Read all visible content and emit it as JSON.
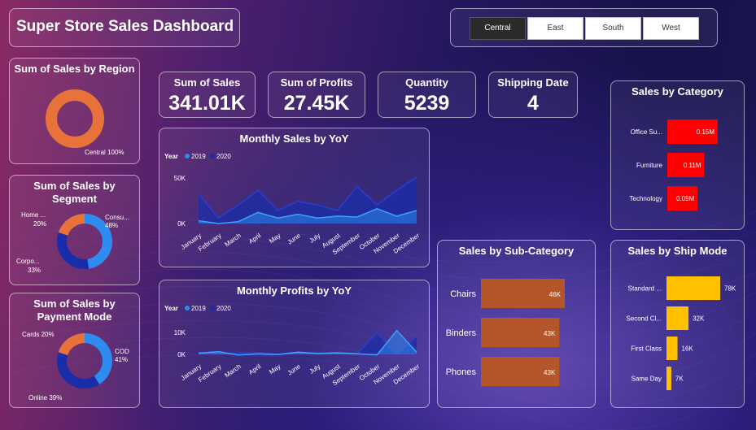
{
  "dashboard": {
    "title": "Super Store Sales Dashboard"
  },
  "region_slicer": {
    "options": [
      "Central",
      "East",
      "South",
      "West"
    ],
    "selected": "Central"
  },
  "region_chart": {
    "title": "Sum of Sales by Region",
    "label": "Central 100%",
    "color": "#E8733A"
  },
  "segment_chart": {
    "title": "Sum of Sales by Segment",
    "slices": [
      {
        "name": "Consu...",
        "pct": "48%",
        "value": 48,
        "color": "#2E8BEF"
      },
      {
        "name": "Corpo...",
        "pct": "33%",
        "value": 33,
        "color": "#1A2DA8"
      },
      {
        "name": "Home ...",
        "pct": "20%",
        "value": 20,
        "color": "#E8733A"
      }
    ]
  },
  "payment_chart": {
    "title": "Sum of Sales by Payment Mode",
    "slices": [
      {
        "name": "COD",
        "pct": "41%",
        "value": 41,
        "color": "#2E8BEF"
      },
      {
        "name": "Online",
        "pct": "39%",
        "value": 39,
        "color": "#1A2DA8"
      },
      {
        "name": "Cards",
        "pct": "20%",
        "value": 20,
        "color": "#E8733A"
      }
    ]
  },
  "kpis": {
    "sales": {
      "label": "Sum of Sales",
      "value": "341.01K"
    },
    "profits": {
      "label": "Sum of Profits",
      "value": "27.45K"
    },
    "quantity": {
      "label": "Quantity",
      "value": "5239"
    },
    "shipping": {
      "label": "Shipping Date",
      "value": "4"
    }
  },
  "monthly_sales": {
    "title": "Monthly Sales by YoY",
    "legend_title": "Year",
    "series_names": [
      "2019",
      "2020"
    ],
    "series_colors": [
      "#2E8BEF",
      "#1A2DA8"
    ],
    "yticks": [
      "50K",
      "0K"
    ],
    "months": [
      "January",
      "February",
      "March",
      "April",
      "May",
      "June",
      "July",
      "August",
      "September",
      "October",
      "November",
      "December"
    ]
  },
  "monthly_profits": {
    "title": "Monthly Profits by YoY",
    "legend_title": "Year",
    "series_names": [
      "2019",
      "2020"
    ],
    "series_colors": [
      "#2E8BEF",
      "#1A2DA8"
    ],
    "yticks": [
      "10K",
      "0K"
    ],
    "months": [
      "January",
      "February",
      "March",
      "April",
      "May",
      "June",
      "July",
      "August",
      "September",
      "October",
      "November",
      "December"
    ]
  },
  "category_chart": {
    "title": "Sales by Category",
    "color": "#FF0000",
    "items": [
      {
        "name": "Office Su...",
        "label": "0.15M",
        "value": 0.15
      },
      {
        "name": "Furniture",
        "label": "0.11M",
        "value": 0.11
      },
      {
        "name": "Technology",
        "label": "0.09M",
        "value": 0.09
      }
    ]
  },
  "subcategory_chart": {
    "title": "Sales by Sub-Category",
    "color": "#B5552A",
    "items": [
      {
        "name": "Chairs",
        "label": "46K",
        "value": 46
      },
      {
        "name": "Binders",
        "label": "43K",
        "value": 43
      },
      {
        "name": "Phones",
        "label": "43K",
        "value": 43
      }
    ]
  },
  "shipmode_chart": {
    "title": "Sales by Ship Mode",
    "color": "#FFC000",
    "items": [
      {
        "name": "Standard ...",
        "label": "78K",
        "value": 78
      },
      {
        "name": "Second Cl...",
        "label": "32K",
        "value": 32
      },
      {
        "name": "First Class",
        "label": "16K",
        "value": 16
      },
      {
        "name": "Same Day",
        "label": "7K",
        "value": 7
      }
    ]
  },
  "chart_data": [
    {
      "type": "area",
      "title": "Monthly Sales by YoY",
      "x": [
        "January",
        "February",
        "March",
        "April",
        "May",
        "June",
        "July",
        "August",
        "September",
        "October",
        "November",
        "December"
      ],
      "ylim": [
        0,
        50000
      ],
      "series": [
        {
          "name": "2019",
          "values": [
            3000,
            0,
            2000,
            12000,
            6000,
            10000,
            6000,
            8000,
            7000,
            16000,
            8000,
            14000
          ]
        },
        {
          "name": "2020",
          "values": [
            32000,
            6000,
            20000,
            36000,
            14000,
            24000,
            20000,
            14000,
            40000,
            20000,
            36000,
            50000
          ]
        }
      ]
    },
    {
      "type": "area",
      "title": "Monthly Profits by YoY",
      "x": [
        "January",
        "February",
        "March",
        "April",
        "May",
        "June",
        "July",
        "August",
        "September",
        "October",
        "November",
        "December"
      ],
      "ylim": [
        0,
        10000
      ],
      "series": [
        {
          "name": "2019",
          "values": [
            500,
            1200,
            -300,
            200,
            -100,
            1000,
            400,
            700,
            300,
            -200,
            10500,
            1000
          ]
        },
        {
          "name": "2020",
          "values": [
            1000,
            400,
            600,
            700,
            200,
            800,
            600,
            300,
            200,
            9500,
            -300,
            8000
          ]
        }
      ]
    }
  ]
}
